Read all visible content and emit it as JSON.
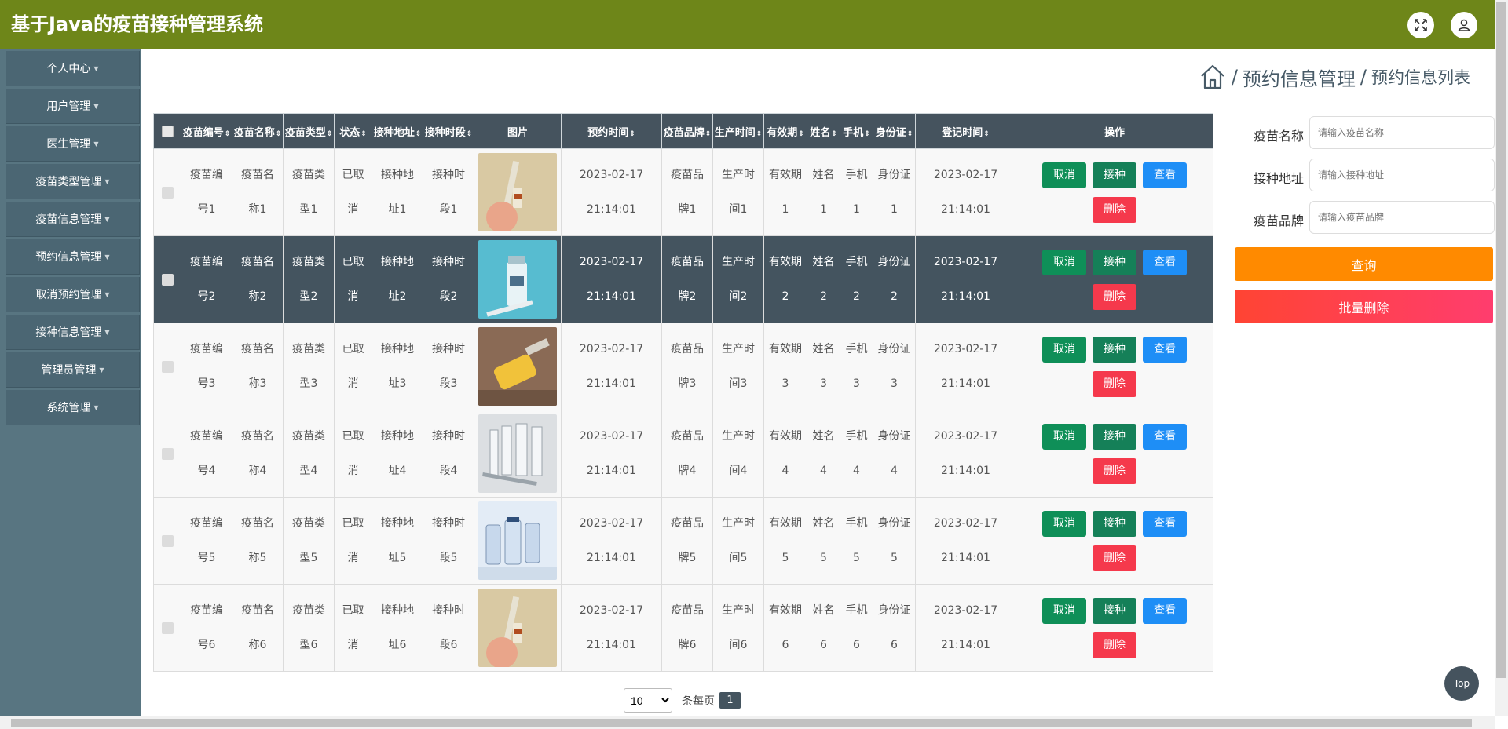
{
  "app": {
    "title": "基于Java的疫苗接种管理系统",
    "icons": {
      "fullscreen": "expand-arrows-icon",
      "user": "user-icon"
    },
    "colors": {
      "topbar": "#6e8619",
      "sidebar": "#587581",
      "sidebar_item": "#4b6673",
      "header": "#45535e"
    }
  },
  "sidebar": {
    "items": [
      {
        "label": "个人中心"
      },
      {
        "label": "用户管理"
      },
      {
        "label": "医生管理"
      },
      {
        "label": "疫苗类型管理"
      },
      {
        "label": "疫苗信息管理"
      },
      {
        "label": "预约信息管理"
      },
      {
        "label": "取消预约管理"
      },
      {
        "label": "接种信息管理"
      },
      {
        "label": "管理员管理"
      },
      {
        "label": "系统管理"
      }
    ]
  },
  "breadcrumb": {
    "home_icon": "home-icon",
    "sep": "/",
    "section": "预约信息管理",
    "page": "预约信息列表"
  },
  "table": {
    "columns": [
      "疫苗编号",
      "疫苗名称",
      "疫苗类型",
      "状态",
      "接种地址",
      "接种时段",
      "图片",
      "预约时间",
      "疫苗品牌",
      "生产时间",
      "有效期",
      "姓名",
      "手机",
      "身份证",
      "登记时间",
      "操作"
    ],
    "rows": [
      {
        "c0": [
          "疫苗编",
          "号1"
        ],
        "c1": [
          "疫苗名",
          "称1"
        ],
        "c2": [
          "疫苗类",
          "型1"
        ],
        "c3": [
          "已取",
          "消"
        ],
        "c4": [
          "接种地",
          "址1"
        ],
        "c5": [
          "接种时",
          "段1"
        ],
        "img": "vaccine-hand-syringe",
        "c7": [
          "2023-02-17",
          "21:14:01"
        ],
        "c8": [
          "疫苗品",
          "牌1"
        ],
        "c9": [
          "生产时",
          "间1"
        ],
        "c10": [
          "有效期",
          "1"
        ],
        "c11": [
          "姓名",
          "1"
        ],
        "c12": [
          "手机",
          "1"
        ],
        "c13": [
          "身份证",
          "1"
        ],
        "c14": [
          "2023-02-17",
          "21:14:01"
        ]
      },
      {
        "c0": [
          "疫苗编",
          "号2"
        ],
        "c1": [
          "疫苗名",
          "称2"
        ],
        "c2": [
          "疫苗类",
          "型2"
        ],
        "c3": [
          "已取",
          "消"
        ],
        "c4": [
          "接种地",
          "址2"
        ],
        "c5": [
          "接种时",
          "段2"
        ],
        "img": "vaccine-vial-teal",
        "c7": [
          "2023-02-17",
          "21:14:01"
        ],
        "c8": [
          "疫苗品",
          "牌2"
        ],
        "c9": [
          "生产时",
          "间2"
        ],
        "c10": [
          "有效期",
          "2"
        ],
        "c11": [
          "姓名",
          "2"
        ],
        "c12": [
          "手机",
          "2"
        ],
        "c13": [
          "身份证",
          "2"
        ],
        "c14": [
          "2023-02-17",
          "21:14:01"
        ]
      },
      {
        "c0": [
          "疫苗编",
          "号3"
        ],
        "c1": [
          "疫苗名",
          "称3"
        ],
        "c2": [
          "疫苗类",
          "型3"
        ],
        "c3": [
          "已取",
          "消"
        ],
        "c4": [
          "接种地",
          "址3"
        ],
        "c5": [
          "接种时",
          "段3"
        ],
        "img": "vaccine-yellow-vial",
        "c7": [
          "2023-02-17",
          "21:14:01"
        ],
        "c8": [
          "疫苗品",
          "牌3"
        ],
        "c9": [
          "生产时",
          "间3"
        ],
        "c10": [
          "有效期",
          "3"
        ],
        "c11": [
          "姓名",
          "3"
        ],
        "c12": [
          "手机",
          "3"
        ],
        "c13": [
          "身份证",
          "3"
        ],
        "c14": [
          "2023-02-17",
          "21:14:01"
        ]
      },
      {
        "c0": [
          "疫苗编",
          "号4"
        ],
        "c1": [
          "疫苗名",
          "称4"
        ],
        "c2": [
          "疫苗类",
          "型4"
        ],
        "c3": [
          "已取",
          "消"
        ],
        "c4": [
          "接种地",
          "址4"
        ],
        "c5": [
          "接种时",
          "段4"
        ],
        "img": "vaccine-vials-grey",
        "c7": [
          "2023-02-17",
          "21:14:01"
        ],
        "c8": [
          "疫苗品",
          "牌4"
        ],
        "c9": [
          "生产时",
          "间4"
        ],
        "c10": [
          "有效期",
          "4"
        ],
        "c11": [
          "姓名",
          "4"
        ],
        "c12": [
          "手机",
          "4"
        ],
        "c13": [
          "身份证",
          "4"
        ],
        "c14": [
          "2023-02-17",
          "21:14:01"
        ]
      },
      {
        "c0": [
          "疫苗编",
          "号5"
        ],
        "c1": [
          "疫苗名",
          "称5"
        ],
        "c2": [
          "疫苗类",
          "型5"
        ],
        "c3": [
          "已取",
          "消"
        ],
        "c4": [
          "接种地",
          "址5"
        ],
        "c5": [
          "接种时",
          "段5"
        ],
        "img": "vaccine-vials-blue",
        "c7": [
          "2023-02-17",
          "21:14:01"
        ],
        "c8": [
          "疫苗品",
          "牌5"
        ],
        "c9": [
          "生产时",
          "间5"
        ],
        "c10": [
          "有效期",
          "5"
        ],
        "c11": [
          "姓名",
          "5"
        ],
        "c12": [
          "手机",
          "5"
        ],
        "c13": [
          "身份证",
          "5"
        ],
        "c14": [
          "2023-02-17",
          "21:14:01"
        ]
      },
      {
        "c0": [
          "疫苗编",
          "号6"
        ],
        "c1": [
          "疫苗名",
          "称6"
        ],
        "c2": [
          "疫苗类",
          "型6"
        ],
        "c3": [
          "已取",
          "消"
        ],
        "c4": [
          "接种地",
          "址6"
        ],
        "c5": [
          "接种时",
          "段6"
        ],
        "img": "vaccine-hand-syringe",
        "c7": [
          "2023-02-17",
          "21:14:01"
        ],
        "c8": [
          "疫苗品",
          "牌6"
        ],
        "c9": [
          "生产时",
          "间6"
        ],
        "c10": [
          "有效期",
          "6"
        ],
        "c11": [
          "姓名",
          "6"
        ],
        "c12": [
          "手机",
          "6"
        ],
        "c13": [
          "身份证",
          "6"
        ],
        "c14": [
          "2023-02-17",
          "21:14:01"
        ]
      }
    ],
    "actions": {
      "cancel": "取消",
      "vaccinate": "接种",
      "view": "查看",
      "delete": "删除"
    },
    "dark_row_index": 1
  },
  "search": {
    "fields": [
      {
        "label": "疫苗名称",
        "placeholder": "请输入疫苗名称"
      },
      {
        "label": "接种地址",
        "placeholder": "请输入接种地址"
      },
      {
        "label": "疫苗品牌",
        "placeholder": "请输入疫苗品牌"
      }
    ],
    "query_button": "查询",
    "batch_delete_button": "批量删除"
  },
  "pagination": {
    "page_size": "10",
    "per_page_label": "条每页",
    "current_page": "1"
  },
  "back_to_top": "Top"
}
